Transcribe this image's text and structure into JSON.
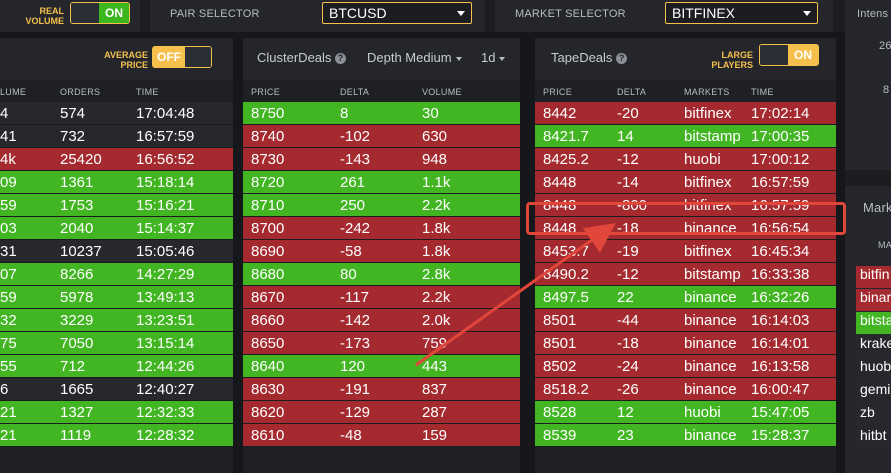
{
  "topbar": {
    "real_volume_label": "REAL VOLUME",
    "real_volume_state": "ON",
    "pair_selector_label": "PAIR SELECTOR",
    "pair_value": "BTCUSD",
    "market_selector_label": "MARKET SELECTOR",
    "market_value": "BITFINEX",
    "intens_label": "Intens"
  },
  "left_panel": {
    "average_price_label": "AVERAGE PRICE",
    "average_price_state": "OFF",
    "columns": [
      "LUME",
      "ORDERS",
      "TIME"
    ],
    "rows": [
      {
        "vol": "4",
        "orders": "574",
        "time": "17:04:48",
        "color": "d"
      },
      {
        "vol": "41",
        "orders": "732",
        "time": "16:57:59",
        "color": "d"
      },
      {
        "vol": "4k",
        "orders": "25420",
        "time": "16:56:52",
        "color": "r"
      },
      {
        "vol": "09",
        "orders": "1361",
        "time": "15:18:14",
        "color": "g"
      },
      {
        "vol": "59",
        "orders": "1753",
        "time": "15:16:21",
        "color": "g"
      },
      {
        "vol": "03",
        "orders": "2040",
        "time": "15:14:37",
        "color": "g"
      },
      {
        "vol": "31",
        "orders": "10237",
        "time": "15:05:46",
        "color": "d"
      },
      {
        "vol": "07",
        "orders": "8266",
        "time": "14:27:29",
        "color": "g"
      },
      {
        "vol": "59",
        "orders": "5978",
        "time": "13:49:13",
        "color": "g"
      },
      {
        "vol": "32",
        "orders": "3229",
        "time": "13:23:51",
        "color": "g"
      },
      {
        "vol": "75",
        "orders": "7050",
        "time": "13:15:14",
        "color": "g"
      },
      {
        "vol": "55",
        "orders": "712",
        "time": "12:44:26",
        "color": "g"
      },
      {
        "vol": "6",
        "orders": "1665",
        "time": "12:40:27",
        "color": "d"
      },
      {
        "vol": "21",
        "orders": "1327",
        "time": "12:32:33",
        "color": "g"
      },
      {
        "vol": "21",
        "orders": "1119",
        "time": "12:28:32",
        "color": "g"
      }
    ]
  },
  "cluster_panel": {
    "title": "ClusterDeals",
    "depth": "Depth Medium",
    "timeframe": "1d",
    "columns": [
      "PRICE",
      "DELTA",
      "VOLUME"
    ],
    "rows": [
      {
        "price": "8750",
        "delta": "8",
        "volume": "30",
        "color": "g"
      },
      {
        "price": "8740",
        "delta": "-102",
        "volume": "630",
        "color": "r"
      },
      {
        "price": "8730",
        "delta": "-143",
        "volume": "948",
        "color": "r"
      },
      {
        "price": "8720",
        "delta": "261",
        "volume": "1.1k",
        "color": "g"
      },
      {
        "price": "8710",
        "delta": "250",
        "volume": "2.2k",
        "color": "g"
      },
      {
        "price": "8700",
        "delta": "-242",
        "volume": "1.8k",
        "color": "r"
      },
      {
        "price": "8690",
        "delta": "-58",
        "volume": "1.8k",
        "color": "r"
      },
      {
        "price": "8680",
        "delta": "80",
        "volume": "2.8k",
        "color": "g"
      },
      {
        "price": "8670",
        "delta": "-117",
        "volume": "2.2k",
        "color": "r"
      },
      {
        "price": "8660",
        "delta": "-142",
        "volume": "2.0k",
        "color": "r"
      },
      {
        "price": "8650",
        "delta": "-173",
        "volume": "759",
        "color": "r"
      },
      {
        "price": "8640",
        "delta": "120",
        "volume": "443",
        "color": "g"
      },
      {
        "price": "8630",
        "delta": "-191",
        "volume": "837",
        "color": "r"
      },
      {
        "price": "8620",
        "delta": "-129",
        "volume": "287",
        "color": "r"
      },
      {
        "price": "8610",
        "delta": "-48",
        "volume": "159",
        "color": "r"
      }
    ]
  },
  "tape_panel": {
    "title": "TapeDeals",
    "large_players_label": "LARGE PLAYERS",
    "large_players_state": "ON",
    "columns": [
      "PRICE",
      "DELTA",
      "MARKETS",
      "TIME"
    ],
    "rows": [
      {
        "price": "8442",
        "delta": "-20",
        "market": "bitfinex",
        "time": "17:02:14",
        "color": "r"
      },
      {
        "price": "8421.7",
        "delta": "14",
        "market": "bitstamp",
        "time": "17:00:35",
        "color": "g"
      },
      {
        "price": "8425.2",
        "delta": "-12",
        "market": "huobi",
        "time": "17:00:12",
        "color": "r"
      },
      {
        "price": "8448",
        "delta": "-14",
        "market": "bitfinex",
        "time": "16:57:59",
        "color": "r"
      },
      {
        "price": "8448",
        "delta": "-800",
        "market": "bitfinex",
        "time": "16:57:59",
        "color": "r"
      },
      {
        "price": "8448",
        "delta": "-18",
        "market": "binance",
        "time": "16:56:54",
        "color": "r"
      },
      {
        "price": "8453.7",
        "delta": "-19",
        "market": "bitfinex",
        "time": "16:45:34",
        "color": "r"
      },
      {
        "price": "8490.2",
        "delta": "-12",
        "market": "bitstamp",
        "time": "16:33:38",
        "color": "r"
      },
      {
        "price": "8497.5",
        "delta": "22",
        "market": "binance",
        "time": "16:32:26",
        "color": "g"
      },
      {
        "price": "8501",
        "delta": "-44",
        "market": "binance",
        "time": "16:14:03",
        "color": "r"
      },
      {
        "price": "8501",
        "delta": "-18",
        "market": "binance",
        "time": "16:14:01",
        "color": "r"
      },
      {
        "price": "8502",
        "delta": "-24",
        "market": "binance",
        "time": "16:13:58",
        "color": "r"
      },
      {
        "price": "8518.2",
        "delta": "-26",
        "market": "binance",
        "time": "16:00:47",
        "color": "r"
      },
      {
        "price": "8528",
        "delta": "12",
        "market": "huobi",
        "time": "15:47:05",
        "color": "g"
      },
      {
        "price": "8539",
        "delta": "23",
        "market": "binance",
        "time": "15:28:37",
        "color": "g"
      }
    ]
  },
  "right_panel": {
    "numbers": [
      "26",
      "8"
    ],
    "markets_label": "Mark",
    "col_label": "MA",
    "markets": [
      {
        "name": "bitfin",
        "color": "r"
      },
      {
        "name": "binar",
        "color": "r"
      },
      {
        "name": "bitsta",
        "color": "g"
      },
      {
        "name": "krake",
        "color": "d"
      },
      {
        "name": "huob",
        "color": "d"
      },
      {
        "name": "gemi",
        "color": "d"
      },
      {
        "name": "zb",
        "color": "d"
      },
      {
        "name": "hitbt",
        "color": "d"
      }
    ]
  },
  "colors": {
    "green": "#41b622",
    "red": "#a52a30",
    "accent": "#f4c14d",
    "annotation": "#e0463a"
  }
}
